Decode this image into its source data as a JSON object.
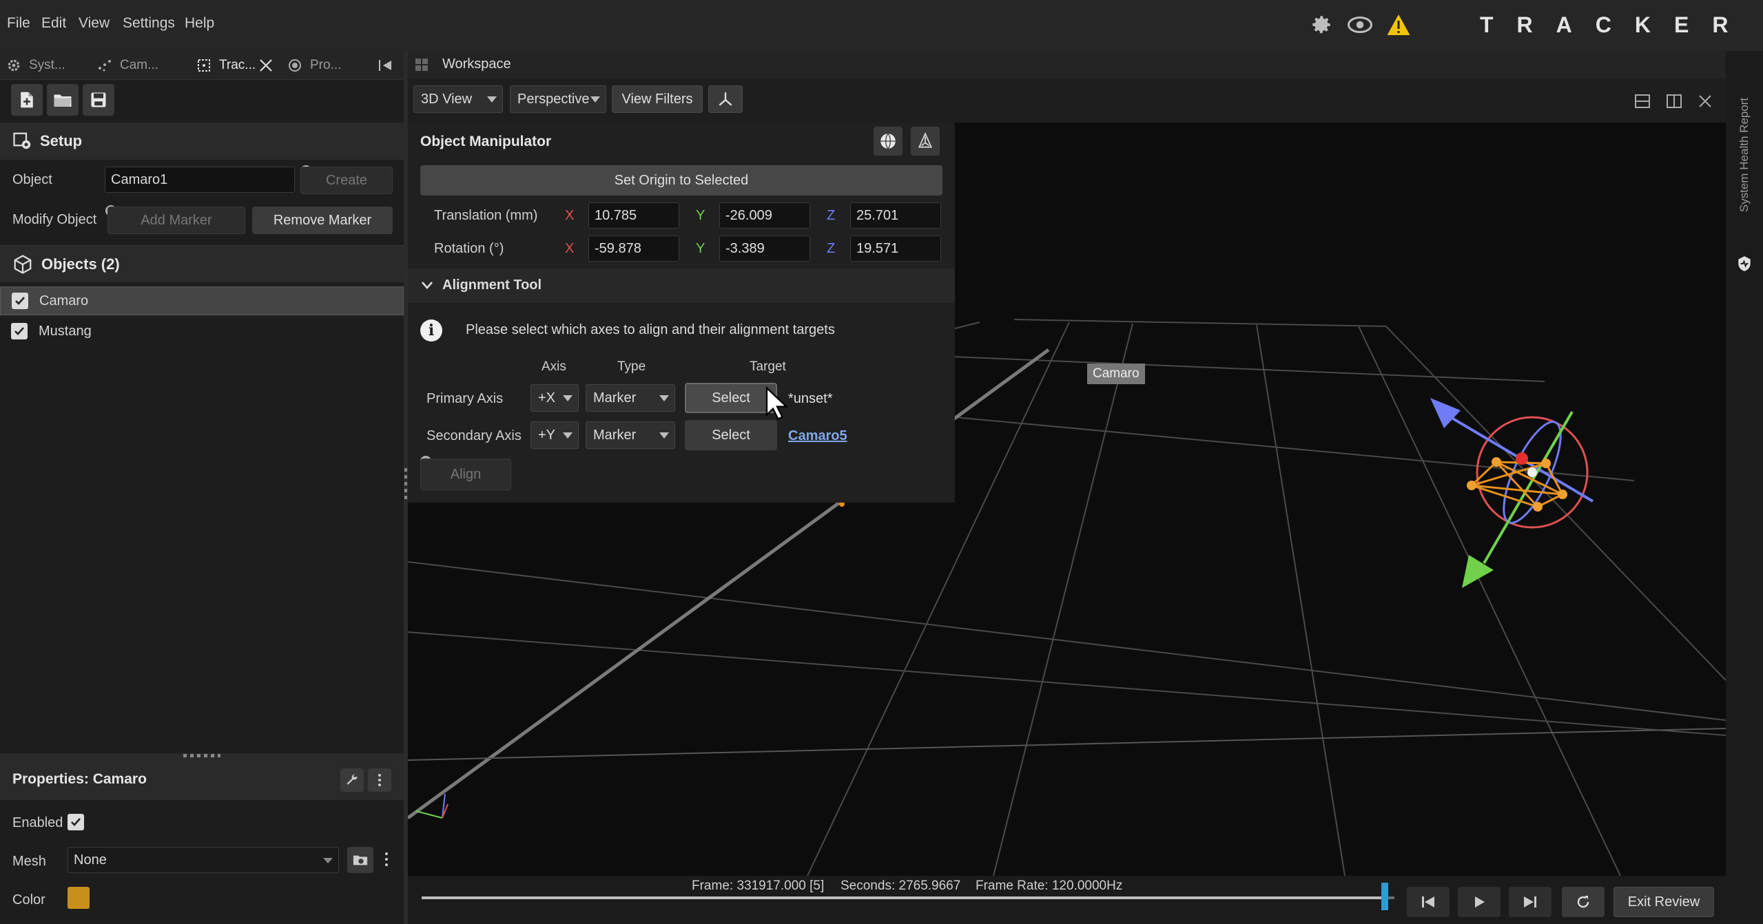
{
  "menu": [
    "File",
    "Edit",
    "View",
    "Settings",
    "Help"
  ],
  "brand": "TRACKER",
  "top_icons": [
    "gear-icon",
    "eye-icon",
    "warning-icon"
  ],
  "left_tabs": [
    {
      "label": "Syst...",
      "icon": "gear-icon"
    },
    {
      "label": "Cam...",
      "icon": "camera-dots-icon"
    },
    {
      "label": "Trac...",
      "icon": "tracking-icon"
    },
    {
      "label": "Pro...",
      "icon": "record-icon"
    }
  ],
  "setup": {
    "title": "Setup",
    "object_label": "Object",
    "object_value": "Camaro1",
    "create_label": "Create",
    "modify_label": "Modify Object",
    "add_marker_label": "Add Marker",
    "remove_marker_label": "Remove Marker"
  },
  "objects": {
    "title": "Objects (2)",
    "items": [
      {
        "label": "Camaro",
        "checked": true,
        "selected": true
      },
      {
        "label": "Mustang",
        "checked": true,
        "selected": false
      }
    ]
  },
  "properties": {
    "title": "Properties: Camaro",
    "enabled_label": "Enabled",
    "enabled": true,
    "mesh_label": "Mesh",
    "mesh_value": "None",
    "color_label": "Color",
    "color_value": "#c8901a"
  },
  "workspace": {
    "tab_label": "Workspace",
    "view_mode": "3D View",
    "projection": "Perspective",
    "view_filters_label": "View Filters"
  },
  "manipulator": {
    "title": "Object Manipulator",
    "set_origin_label": "Set Origin to Selected",
    "translation_label": "Translation (mm)",
    "rotation_label": "Rotation (°)",
    "axis_x": "X",
    "axis_y": "Y",
    "axis_z": "Z",
    "translation": {
      "x": "10.785",
      "y": "-26.009",
      "z": "25.701"
    },
    "rotation": {
      "x": "-59.878",
      "y": "-3.389",
      "z": "19.571"
    }
  },
  "alignment": {
    "title": "Alignment Tool",
    "info": "Please select which axes to align and their alignment targets",
    "col_axis": "Axis",
    "col_type": "Type",
    "col_target": "Target",
    "primary": {
      "label": "Primary Axis",
      "axis": "+X",
      "type": "Marker",
      "select_label": "Select",
      "target": "*unset*"
    },
    "secondary": {
      "label": "Secondary Axis",
      "axis": "+Y",
      "type": "Marker",
      "select_label": "Select",
      "target": "Camaro5"
    },
    "align_label": "Align"
  },
  "viewport": {
    "object_label": "Camaro"
  },
  "status": {
    "frame": "Frame: 331917.000 [5]",
    "seconds": "Seconds: 2765.9667",
    "frame_rate": "Frame Rate: 120.0000Hz",
    "exit_review_label": "Exit Review",
    "timeline_fraction": 0.99
  },
  "right_strip_label": "System Health Report",
  "colors": {
    "axis_x": "#e05050",
    "axis_y": "#6fd24a",
    "axis_z": "#6f7cf5",
    "warning": "#f2c400"
  }
}
